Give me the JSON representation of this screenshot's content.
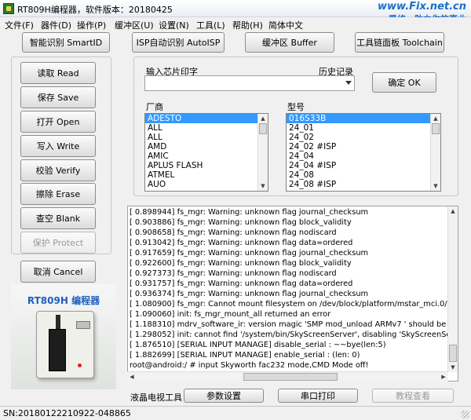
{
  "window": {
    "title": "RT809H编程器，软件版本：20180425",
    "watermark_top": "www.Fix.net.cn",
    "watermark_bottom": "爱修，助力你的事业"
  },
  "menu": [
    "文件(F)",
    "器件(D)",
    "操作(P)",
    "缓冲区(U)",
    "设置(N)",
    "工具(L)",
    "帮助(H)",
    "简体中文"
  ],
  "top_buttons": {
    "smartid": "智能识别 SmartID",
    "autoisp": "ISP自动识别 AutoISP",
    "buffer": "缓冲区 Buffer",
    "toolchain": "工具链面板 Toolchain"
  },
  "left_buttons": {
    "read": "读取 Read",
    "save": "保存 Save",
    "open": "打开 Open",
    "write": "写入 Write",
    "verify": "校验 Verify",
    "erase": "擦除 Erase",
    "blank": "查空 Blank",
    "protect": "保护 Protect",
    "cancel": "取消 Cancel"
  },
  "chip_input": {
    "label": "输入芯片印字",
    "history_label": "历史记录",
    "value": "",
    "confirm": "确定 OK"
  },
  "vendor_list": {
    "label": "厂商",
    "items": [
      "ADESTO",
      "ALL",
      "ALL",
      "AMD",
      "AMIC",
      "APLUS FLASH",
      "ATMEL",
      "AUO"
    ],
    "selected": "ADESTO"
  },
  "model_list": {
    "label": "型号",
    "items": [
      "016S33B",
      "24_01",
      "24_02",
      "24_02 #ISP",
      "24_04",
      "24_04 #ISP",
      "24_08",
      "24_08 #ISP"
    ],
    "selected": "016S33B"
  },
  "device_image": {
    "label": "RT809H 编程器"
  },
  "log_lines": [
    "[    0.898944] fs_mgr: Warning: unknown flag journal_checksum",
    "[    0.903886] fs_mgr: Warning: unknown flag block_validity",
    "[    0.908658] fs_mgr: Warning: unknown flag nodiscard",
    "[    0.913042] fs_mgr: Warning: unknown flag data=ordered",
    "[    0.917659] fs_mgr: Warning: unknown flag journal_checksum",
    "[    0.922600] fs_mgr: Warning: unknown flag block_validity",
    "[    0.927373] fs_mgr: Warning: unknown flag nodiscard",
    "[    0.931757] fs_mgr: Warning: unknown flag data=ordered",
    "[    0.936374] fs_mgr: Warning: unknown flag journal_checksum",
    "[    1.080900] fs_mgr: Cannot mount filesystem on /dev/block/platform/mstar_mci.0/by-na",
    "[    1.090060] init: fs_mgr_mount_all returned an error",
    "[    1.188310] mdrv_software_ir: version magic 'SMP mod_unload ARMv7 ' should be '3",
    "[    1.298052] init: cannot find '/system/bin/SkyScreenServer', disabling 'SkyScreenServe",
    "[    1.876510] [SERIAL INPUT MANAGE] disable_serial : ~~bye(len:5)",
    "[    1.882699] [SERIAL INPUT MANAGE] enable_serial : (len: 0)",
    "root@android:/ # input Skyworth fac232 mode,CMD Mode off!"
  ],
  "bottom_toolbar": {
    "label": "液晶电视工具",
    "params": "参数设置",
    "serial": "串口打印",
    "tutorial": "教程查看"
  },
  "status": {
    "serial_number": "SN:20180122210922-048865"
  }
}
